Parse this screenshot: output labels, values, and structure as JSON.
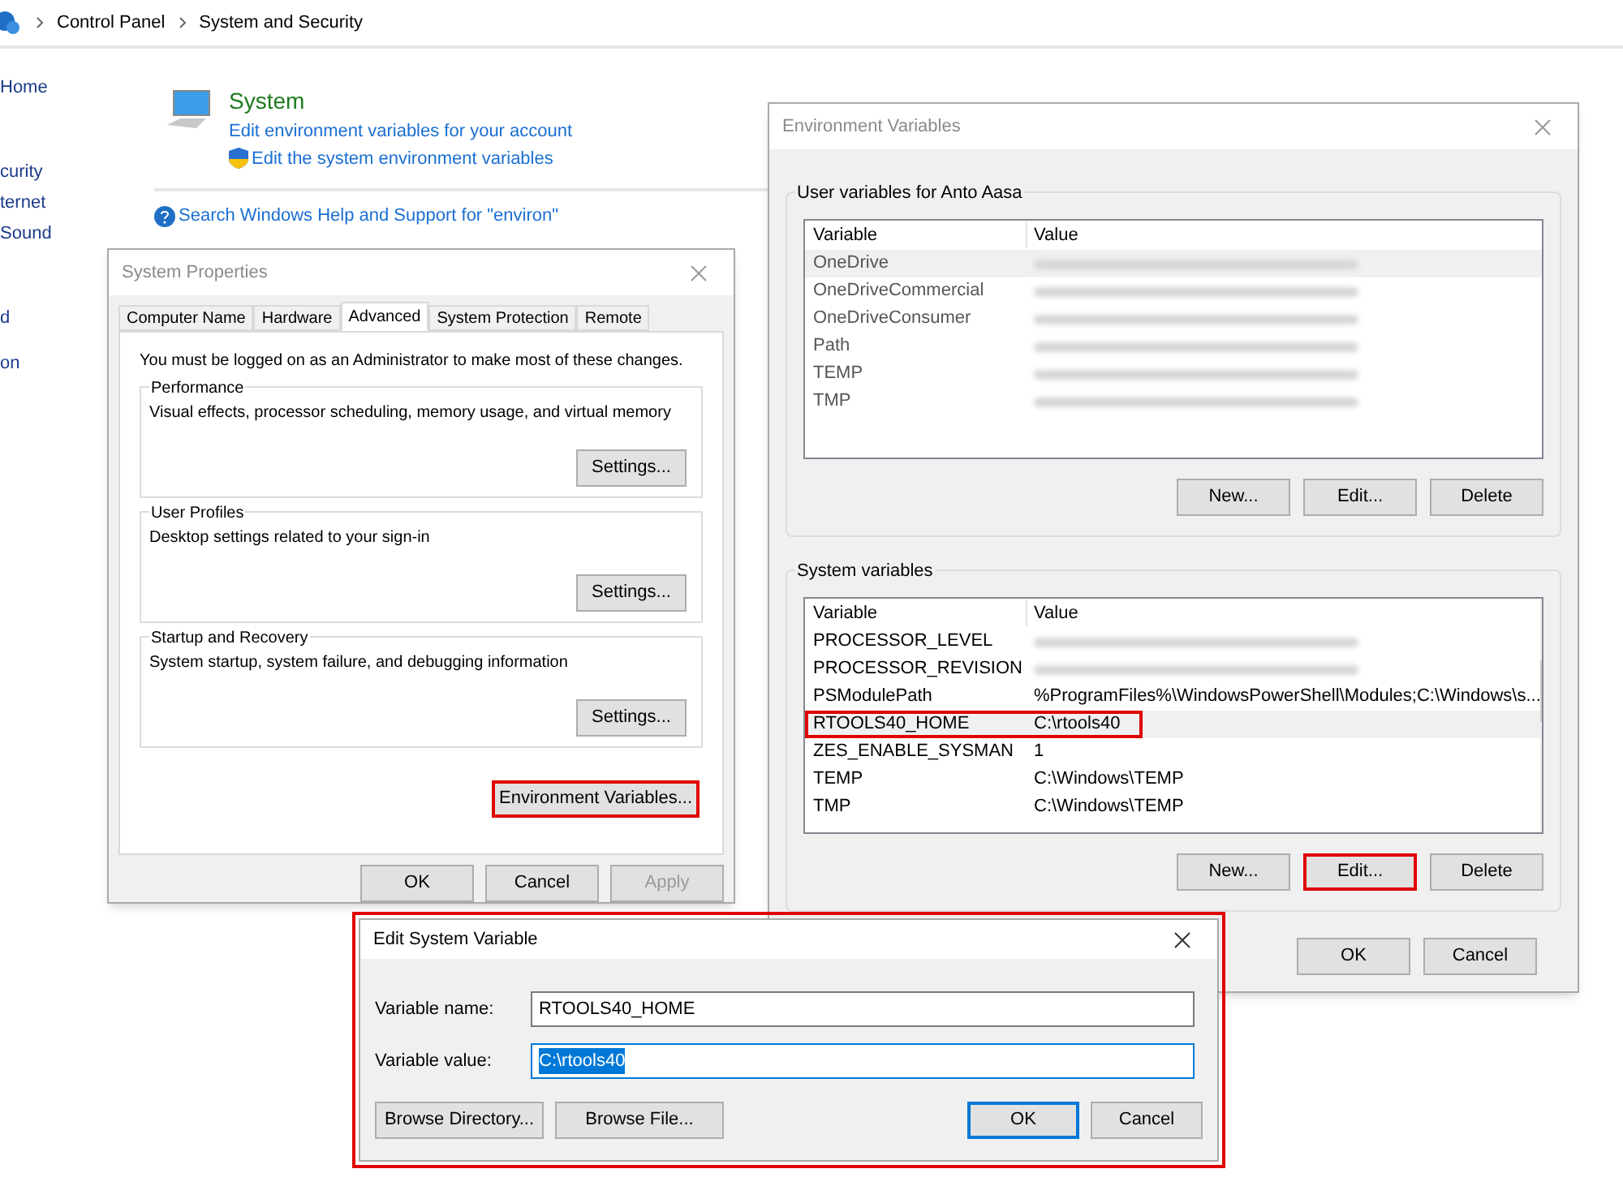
{
  "breadcrumb": [
    "Control Panel",
    "System and Security"
  ],
  "sidebar": {
    "items": [
      "Home",
      "curity",
      "ternet",
      "Sound",
      "d",
      "on"
    ]
  },
  "section": {
    "title": "System",
    "links": [
      {
        "text": "Edit environment variables for your account",
        "shield": false
      },
      {
        "text": "Edit the system environment variables",
        "shield": true
      }
    ],
    "help": "Search Windows Help and Support for \"environ\""
  },
  "system_properties": {
    "title": "System Properties",
    "tabs": [
      {
        "label": "Computer Name",
        "selected": false
      },
      {
        "label": "Hardware",
        "selected": false
      },
      {
        "label": "Advanced",
        "selected": true
      },
      {
        "label": "System Protection",
        "selected": false
      },
      {
        "label": "Remote",
        "selected": false
      }
    ],
    "notice": "You must be logged on as an Administrator to make most of these changes.",
    "groups": [
      {
        "title": "Performance",
        "description": "Visual effects, processor scheduling, memory usage, and virtual memory",
        "button": "Settings..."
      },
      {
        "title": "User Profiles",
        "description": "Desktop settings related to your sign-in",
        "button": "Settings..."
      },
      {
        "title": "Startup and Recovery",
        "description": "System startup, system failure, and debugging information",
        "button": "Settings..."
      }
    ],
    "env_button": {
      "label": "Environment Variables...",
      "highlighted": true
    },
    "buttons": [
      {
        "label": "OK",
        "disabled": false
      },
      {
        "label": "Cancel",
        "disabled": false
      },
      {
        "label": "Apply",
        "disabled": true
      }
    ]
  },
  "env_vars": {
    "title": "Environment Variables",
    "user": {
      "title": "User variables for Anto Aasa",
      "columns": [
        "Variable",
        "Value"
      ],
      "rows": [
        {
          "name": "OneDrive",
          "blurred": true,
          "selected": true,
          "highlighted": false
        },
        {
          "name": "OneDriveCommercial",
          "blurred": true,
          "selected": false,
          "highlighted": false
        },
        {
          "name": "OneDriveConsumer",
          "blurred": true,
          "selected": false,
          "highlighted": false
        },
        {
          "name": "Path",
          "blurred": true,
          "selected": false,
          "highlighted": false
        },
        {
          "name": "TEMP",
          "blurred": true,
          "selected": false,
          "highlighted": false
        },
        {
          "name": "TMP",
          "blurred": true,
          "selected": false,
          "highlighted": false
        }
      ],
      "buttons": [
        {
          "label": "New...",
          "highlighted": false
        },
        {
          "label": "Edit...",
          "highlighted": false
        },
        {
          "label": "Delete",
          "highlighted": false
        }
      ]
    },
    "system": {
      "title": "System variables",
      "columns": [
        "Variable",
        "Value"
      ],
      "rows": [
        {
          "name": "PROCESSOR_LEVEL",
          "blurred": true,
          "selected": false,
          "highlighted": false
        },
        {
          "name": "PROCESSOR_REVISION",
          "blurred": true,
          "selected": false,
          "highlighted": false
        },
        {
          "name": "PSModulePath",
          "value": "%ProgramFiles%\\WindowsPowerShell\\Modules;C:\\Windows\\s...",
          "blurred": false,
          "selected": false,
          "highlighted": false
        },
        {
          "name": "RTOOLS40_HOME",
          "value": "C:\\rtools40",
          "blurred": false,
          "selected": true,
          "highlighted": true
        },
        {
          "name": "ZES_ENABLE_SYSMAN",
          "value": "1",
          "blurred": false,
          "selected": false,
          "highlighted": false
        },
        {
          "name": "TEMP",
          "value": "C:\\Windows\\TEMP",
          "blurred": false,
          "selected": false,
          "highlighted": false
        },
        {
          "name": "TMP",
          "value": "C:\\Windows\\TEMP",
          "blurred": false,
          "selected": false,
          "highlighted": false
        }
      ],
      "buttons": [
        {
          "label": "New...",
          "highlighted": false
        },
        {
          "label": "Edit...",
          "highlighted": true
        },
        {
          "label": "Delete",
          "highlighted": false
        }
      ]
    },
    "buttons": [
      "OK",
      "Cancel"
    ]
  },
  "edit_dialog": {
    "title": "Edit System Variable",
    "highlighted": true,
    "fields": [
      {
        "label": "Variable name:",
        "value": "RTOOLS40_HOME",
        "focused": false
      },
      {
        "label": "Variable value:",
        "value": "C:\\rtools40",
        "focused": true
      }
    ],
    "buttons": [
      {
        "label": "Browse Directory...",
        "default": false
      },
      {
        "label": "Browse File...",
        "default": false
      },
      {
        "label": "OK",
        "default": true
      },
      {
        "label": "Cancel",
        "default": false
      }
    ]
  }
}
